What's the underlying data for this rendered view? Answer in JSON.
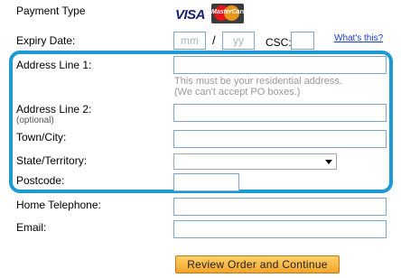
{
  "payment": {
    "label": "Payment Type",
    "cards": [
      "visa-icon",
      "mastercard-icon"
    ],
    "visa_text": "VISA",
    "mastercard_text": "MasterCard"
  },
  "expiry": {
    "label": "Expiry Date:",
    "month_placeholder": "mm",
    "separator": "/",
    "year_placeholder": "yy",
    "csc_label": "CSC:",
    "whats_this_link": "What's this?"
  },
  "address1": {
    "label": "Address Line 1:",
    "hint_line1": "This must be your residential address.",
    "hint_line2": "(We can't accept PO boxes.)"
  },
  "address2": {
    "label": "Address Line 2:",
    "optional_note": "(optional)"
  },
  "town": {
    "label": "Town/City:"
  },
  "state": {
    "label": "State/Territory:",
    "selected": ""
  },
  "postcode": {
    "label": "Postcode:"
  },
  "phone": {
    "label": "Home Telephone:"
  },
  "email": {
    "label": "Email:"
  },
  "submit": {
    "label": "Review Order and Continue"
  },
  "colors": {
    "highlight": "#1d9ad6",
    "button": "#f3a52a",
    "input_border": "#7fa6c9",
    "link": "#1a3ccf"
  }
}
